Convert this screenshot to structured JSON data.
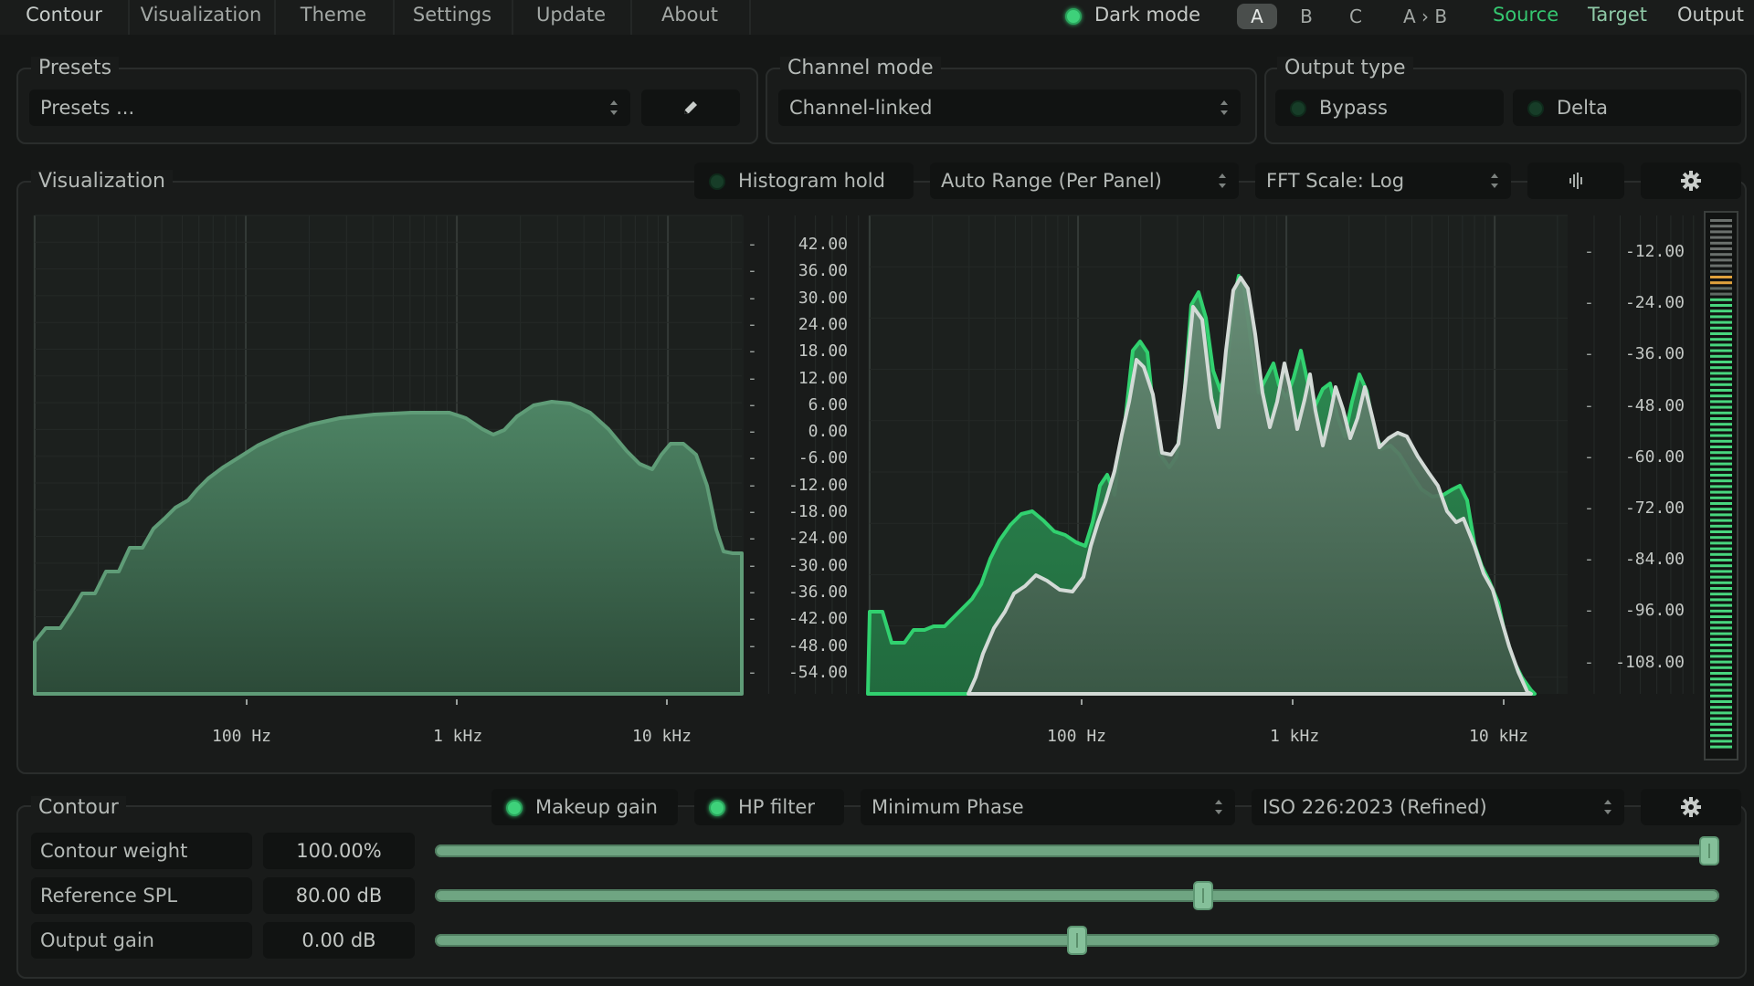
{
  "menu": {
    "tabs": [
      "Contour",
      "Visualization",
      "Theme",
      "Settings",
      "Update",
      "About"
    ],
    "dark_mode_label": "Dark mode",
    "ab_buttons": [
      "A",
      "B",
      "C",
      "A › B"
    ],
    "ab_active": "A",
    "view_buttons": [
      "Source",
      "Target",
      "Output"
    ]
  },
  "presets": {
    "title": "Presets",
    "value": "Presets ..."
  },
  "channel_mode": {
    "title": "Channel mode",
    "value": "Channel-linked"
  },
  "output_type": {
    "title": "Output type",
    "options": [
      "Bypass",
      "Delta"
    ]
  },
  "visualization": {
    "title": "Visualization",
    "histogram_hold": "Histogram hold",
    "range_mode": "Auto Range (Per Panel)",
    "fft_scale": "FFT Scale: Log",
    "left_plot": {
      "y_ticks": [
        "42.00",
        "36.00",
        "30.00",
        "24.00",
        "18.00",
        "12.00",
        "6.00",
        "0.00",
        "-6.00",
        "-12.00",
        "-18.00",
        "-24.00",
        "-30.00",
        "-36.00",
        "-42.00",
        "-48.00",
        "-54.00"
      ],
      "x_ticks": [
        "100 Hz",
        "1 kHz",
        "10 kHz"
      ]
    },
    "right_plot": {
      "y_ticks": [
        "-12.00",
        "-24.00",
        "-36.00",
        "-48.00",
        "-60.00",
        "-72.00",
        "-84.00",
        "-96.00",
        "-108.00"
      ],
      "x_ticks": [
        "100 Hz",
        "1 kHz",
        "10 kHz"
      ]
    }
  },
  "contour": {
    "title": "Contour",
    "makeup_gain": "Makeup gain",
    "hp_filter": "HP filter",
    "phase_mode": "Minimum Phase",
    "standard": "ISO 226:2023 (Refined)",
    "sliders": [
      {
        "label": "Contour weight",
        "value": "100.00%",
        "fraction": 1.0
      },
      {
        "label": "Reference SPL",
        "value": "80.00 dB",
        "fraction": 0.6
      },
      {
        "label": "Output gain",
        "value": "0.00 dB",
        "fraction": 0.5
      }
    ]
  },
  "colors": {
    "accent_green": "#35c770",
    "fill_green": "#4f8a66",
    "source_line": "#2fd46e",
    "output_line": "#d7ddd9"
  }
}
